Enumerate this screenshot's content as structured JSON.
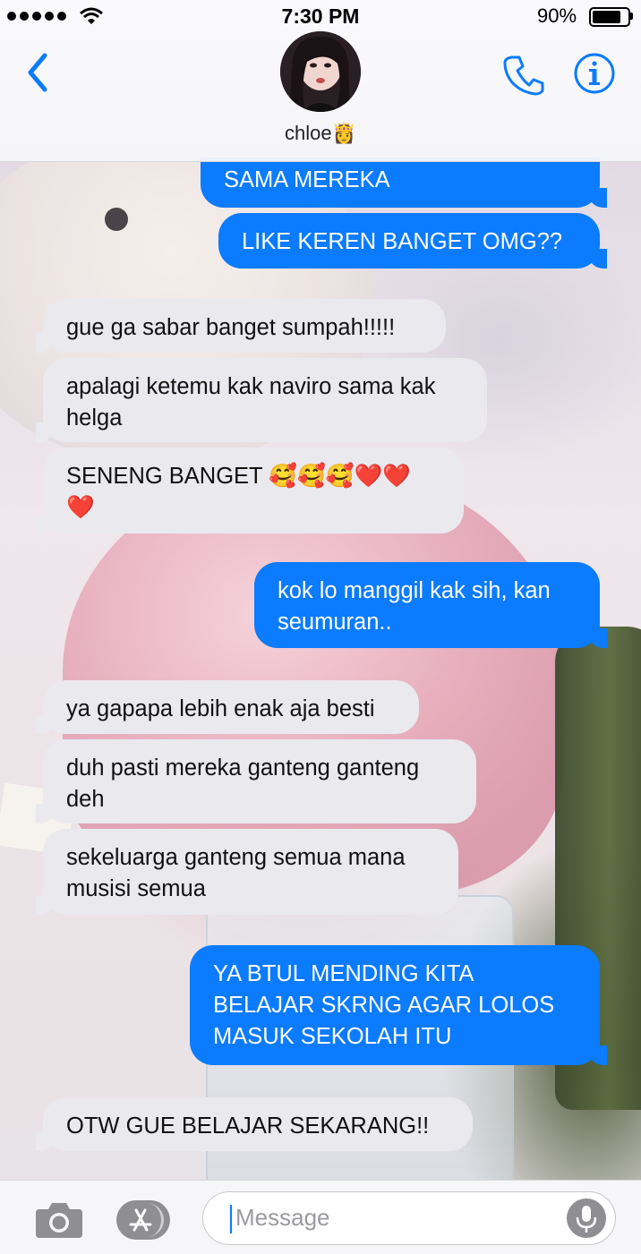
{
  "status_bar": {
    "time": "7:30 PM",
    "battery": "90%",
    "battery_level": 0.9
  },
  "header": {
    "contact_name": "chloe👸",
    "back_icon": "chevron-left-icon",
    "call_icon": "phone-icon",
    "info_icon": "info-icon"
  },
  "messages": [
    {
      "from": "me",
      "text": "SAMA MEREKA"
    },
    {
      "from": "me",
      "text": "LIKE KEREN BANGET OMG??"
    },
    {
      "from": "contact",
      "text": "gue ga sabar banget sumpah!!!!!"
    },
    {
      "from": "contact",
      "text": "apalagi ketemu kak naviro sama kak helga"
    },
    {
      "from": "contact",
      "text": "SENENG BANGET 🥰🥰🥰❤️❤️ ❤️"
    },
    {
      "from": "me",
      "text": "kok lo manggil kak sih, kan seumuran.."
    },
    {
      "from": "contact",
      "text": "ya gapapa lebih enak aja besti"
    },
    {
      "from": "contact",
      "text": "duh pasti mereka ganteng ganteng deh"
    },
    {
      "from": "contact",
      "text": "sekeluarga ganteng semua mana musisi semua"
    },
    {
      "from": "me",
      "text": "YA BTUL MENDING KITA BELAJAR SKRNG AGAR LOLOS MASUK SEKOLAH ITU"
    },
    {
      "from": "contact",
      "text": "OTW GUE BELAJAR SEKARANG!!"
    }
  ],
  "input_bar": {
    "placeholder": "Message",
    "camera_icon": "camera-icon",
    "apps_icon": "app-store-icon",
    "mic_icon": "microphone-icon"
  },
  "colors": {
    "sent_bubble": "#0b7bff",
    "received_bubble": "#e9e9ee",
    "accent": "#0b7bff"
  }
}
